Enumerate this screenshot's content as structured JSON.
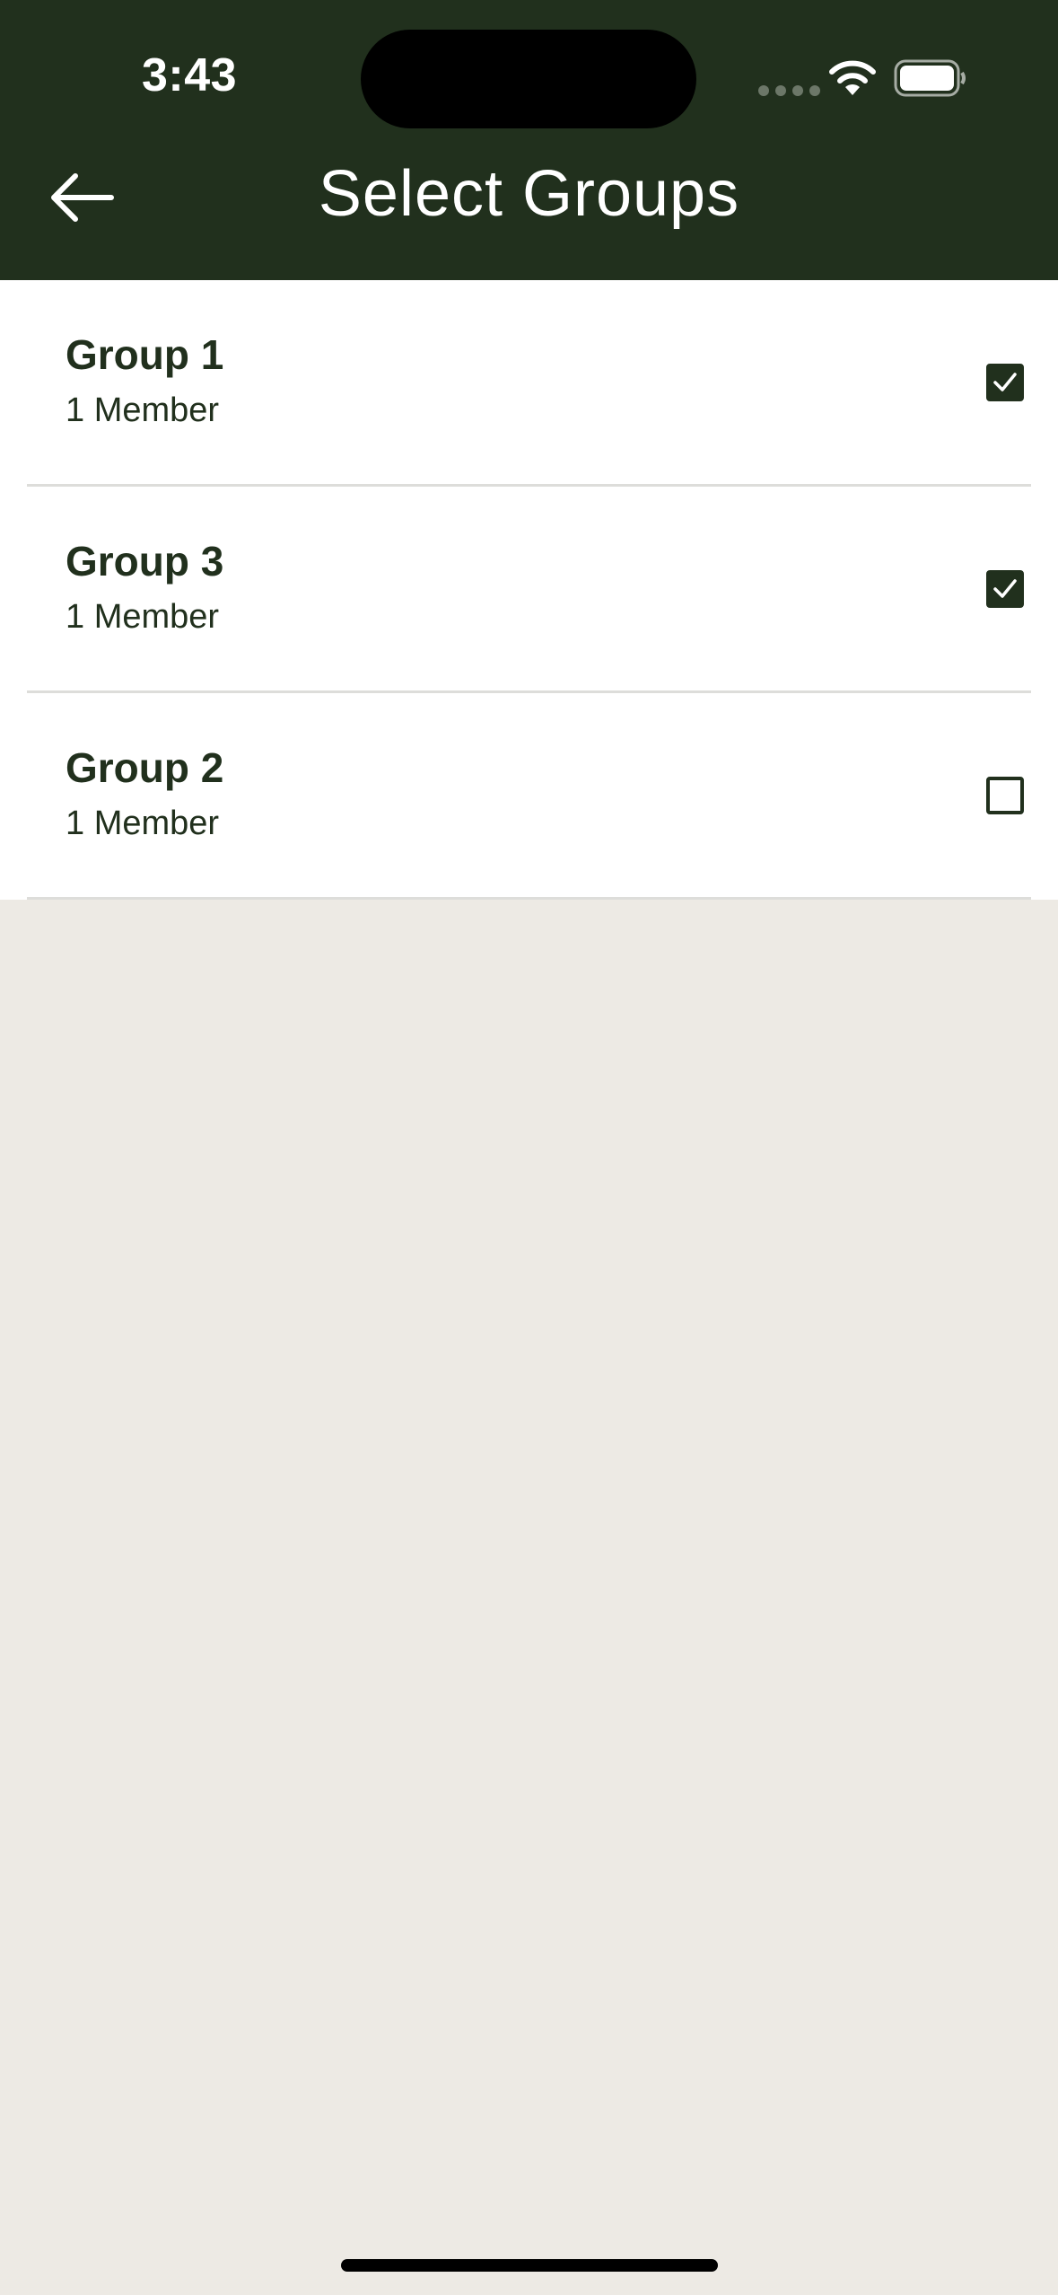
{
  "status_bar": {
    "time": "3:43"
  },
  "header": {
    "title": "Select Groups",
    "back_icon": "arrow-left-icon"
  },
  "groups": [
    {
      "name": "Group 1",
      "members": "1 Member",
      "checked": true
    },
    {
      "name": "Group 3",
      "members": "1 Member",
      "checked": true
    },
    {
      "name": "Group 2",
      "members": "1 Member",
      "checked": false
    }
  ],
  "colors": {
    "header_bg": "#21301D",
    "page_bg": "#EDEAE4",
    "row_bg": "#FFFFFF",
    "accent": "#21301D"
  }
}
